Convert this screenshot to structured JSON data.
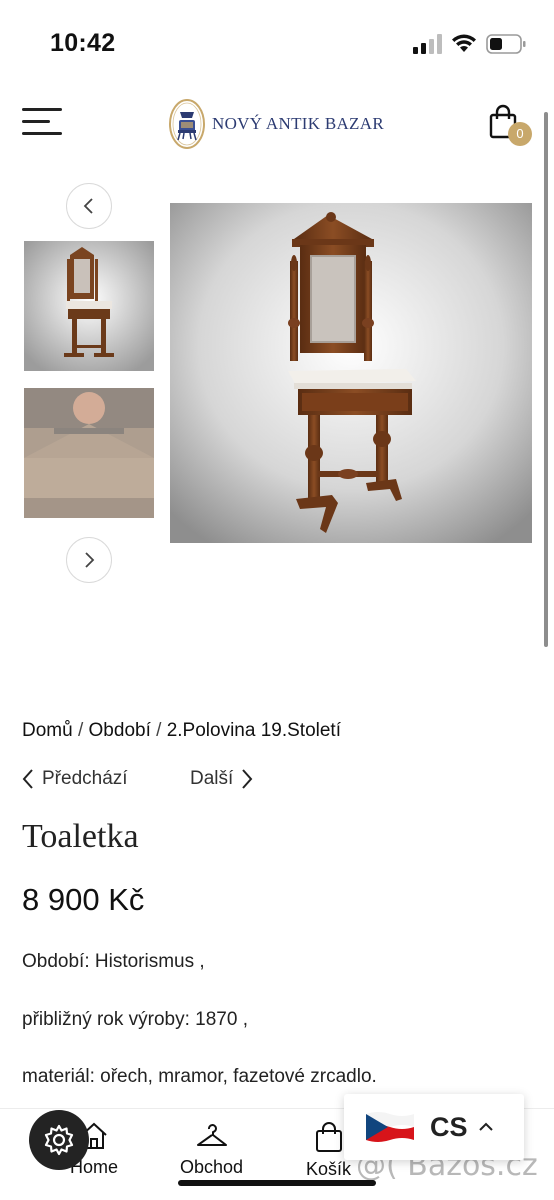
{
  "status_bar": {
    "time": "10:42"
  },
  "header": {
    "logo_text": "NOVÝ ANTIK BAZAR",
    "cart_count": "0"
  },
  "breadcrumb": {
    "items": [
      "Domů",
      "Období",
      "2.Polovina 19.Století"
    ],
    "separator": "/"
  },
  "navigation": {
    "prev_label": "Předchází",
    "next_label": "Další"
  },
  "product": {
    "title": "Toaletka",
    "price": "8 900 Kč",
    "description": [
      "Období: Historismus ,",
      "přibližný rok výroby: 1870 ,",
      "materiál: ořech, mramor, fazetové zrcadlo."
    ]
  },
  "bottom_nav": {
    "tabs": [
      {
        "label": "Home",
        "icon": "home-icon"
      },
      {
        "label": "Obchod",
        "icon": "hanger-icon"
      },
      {
        "label": "Košík",
        "icon": "bag-icon"
      }
    ]
  },
  "language": {
    "code": "CS",
    "flag": "czech-flag"
  },
  "watermark": "@( Bazos.cz",
  "colors": {
    "accent": "#c8a86b",
    "brand": "#2c3b72"
  }
}
